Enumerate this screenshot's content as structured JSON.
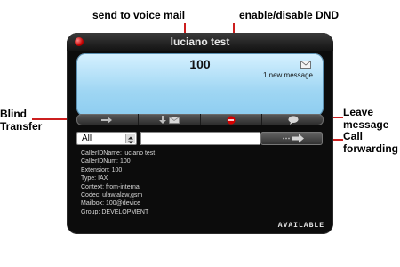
{
  "callouts": {
    "voicemail": "send to voice mail",
    "dnd": "enable/disable DND",
    "blind": "Blind Transfer",
    "leave": "Leave message",
    "forward": "Call forwarding"
  },
  "window": {
    "title": "luciano test"
  },
  "screen": {
    "extension": "100",
    "new_message": "1 new message"
  },
  "controls": {
    "filter_value": "All",
    "dial_value": ""
  },
  "info": [
    "CallerIDName: luciano test",
    "CallerIDNum: 100",
    "Extension: 100",
    "Type: IAX",
    "Context: from-internal",
    "Codec: ulaw,alaw,gsm",
    "Mailbox: 100@device",
    "Group: DEVELOPMENT"
  ],
  "status": "AVAILABLE",
  "colors": {
    "callout_line": "#cc1f1f",
    "screen": "#a9ddf5",
    "body": "#0c0c0c",
    "dnd_red": "#d40000"
  }
}
